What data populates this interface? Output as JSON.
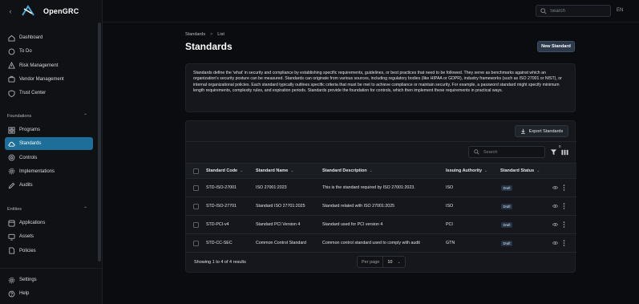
{
  "app": {
    "name": "OpenGRC",
    "lang": "EN"
  },
  "topbar": {
    "search_placeholder": "Search"
  },
  "sidebar": {
    "items_top": [
      {
        "label": "Dashboard",
        "icon": "home-icon"
      },
      {
        "label": "To Do",
        "icon": "circle-icon"
      },
      {
        "label": "Risk Management",
        "icon": "alert-icon"
      },
      {
        "label": "Vendor Management",
        "icon": "briefcase-icon"
      },
      {
        "label": "Trust Center",
        "icon": "shield-icon"
      }
    ],
    "foundations_label": "Foundations",
    "items_foundations": [
      {
        "label": "Programs",
        "icon": "grid-icon"
      },
      {
        "label": "Standards",
        "icon": "cloud-icon",
        "active": true
      },
      {
        "label": "Controls",
        "icon": "target-icon"
      },
      {
        "label": "Implementations",
        "icon": "gear-icon"
      },
      {
        "label": "Audits",
        "icon": "pen-icon"
      }
    ],
    "entities_label": "Entities",
    "items_entities": [
      {
        "label": "Applications",
        "icon": "app-icon"
      },
      {
        "label": "Assets",
        "icon": "monitor-icon"
      },
      {
        "label": "Policies",
        "icon": "doc-icon"
      }
    ],
    "items_bottom": [
      {
        "label": "Settings",
        "icon": "gear-icon"
      },
      {
        "label": "Help",
        "icon": "help-icon"
      }
    ]
  },
  "main": {
    "breadcrumb": [
      "Standards",
      "List"
    ],
    "breadcrumb_sep": ">",
    "title": "Standards",
    "new_button": "New Standard",
    "description": "Standards define the 'what' in security and compliance by establishing specific requirements, guidelines, or best practices that need to be followed. They serve as benchmarks against which an organization's security posture can be measured. Standards can originate from various sources, including regulatory bodies (like HIPAA or GDPR), industry frameworks (such as ISO 27001 or NIST), or internal organizational policies. Each standard typically outlines specific criteria that must be met to achieve compliance or maintain security. For example, a password standard might specify minimum length requirements, complexity rules, and expiration periods. Standards provide the foundation for controls, which then implement these requirements in practical ways."
  },
  "table": {
    "export_button": "Export Standards",
    "search_placeholder": "Search",
    "filter_count": "0",
    "columns": [
      "Standard Code",
      "Standard Name",
      "Standard Description",
      "Issuing Authority",
      "Standard Status"
    ],
    "rows": [
      {
        "code": "STD-ISO-27001",
        "name": "ISO 27001:2023",
        "description": "This is the standard required by ISO 27001:2023.",
        "authority": "ISO",
        "status": "Draft"
      },
      {
        "code": "STD-ISO-27701",
        "name": "Standard ISO 27701:2025",
        "description": "Standard related with ISO 27001:2025",
        "authority": "ISO",
        "status": "Draft"
      },
      {
        "code": "STD-PCI-v4",
        "name": "Standard PCI Version 4",
        "description": "Standard used for PCI version 4",
        "authority": "PCI",
        "status": "Draft"
      },
      {
        "code": "STD-CC-SEC",
        "name": "Common Control Standard",
        "description": "Common control standard used to comply with audit",
        "authority": "GTN",
        "status": "Draft"
      }
    ],
    "footer_text": "Showing 1 to 4 of 4 results",
    "per_page_label": "Per page",
    "per_page_value": "10"
  }
}
